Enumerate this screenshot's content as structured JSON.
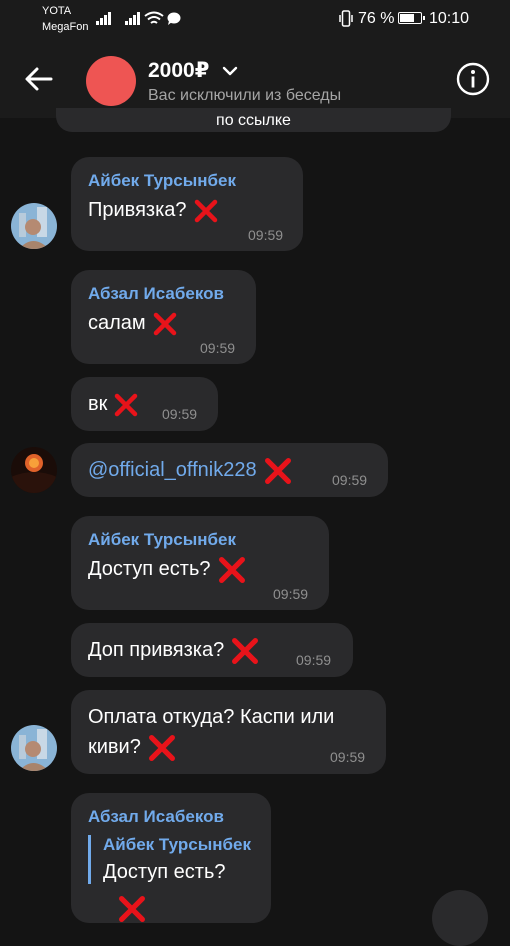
{
  "status_bar": {
    "carrier1": "YOTA",
    "carrier2": "MegaFon",
    "battery_percent": "76 %",
    "battery_level": 0.76,
    "time": "10:10"
  },
  "header": {
    "title": "2000₽",
    "subtitle": "Вас исключили из беседы",
    "avatar_color": "#ee5553"
  },
  "pinned": {
    "text": "по ссылке"
  },
  "messages": [
    {
      "sender": "Айбек Турсынбек",
      "text": "Привязка?",
      "time": "09:59"
    },
    {
      "sender": "Абзал Исабеков",
      "text": "салам",
      "time": "09:59"
    },
    {
      "text": "вк",
      "time": "09:59"
    },
    {
      "text": "@official_offnik228",
      "time": "09:59"
    },
    {
      "sender": "Айбек Турсынбек",
      "text": "Доступ есть?",
      "time": "09:59"
    },
    {
      "text": "Доп привязка?",
      "time": "09:59"
    },
    {
      "line1": "Оплата откуда? Каспи или",
      "line2": "киви?",
      "time": "09:59"
    },
    {
      "sender": "Абзал Исабеков",
      "quote_sender": "Айбек Турсынбек",
      "quote_text": "Доступ есть?"
    }
  ],
  "colors": {
    "link": "#71aaeb",
    "bubble": "#2a2a2c",
    "background": "#141414",
    "cross": "#e8131a"
  }
}
